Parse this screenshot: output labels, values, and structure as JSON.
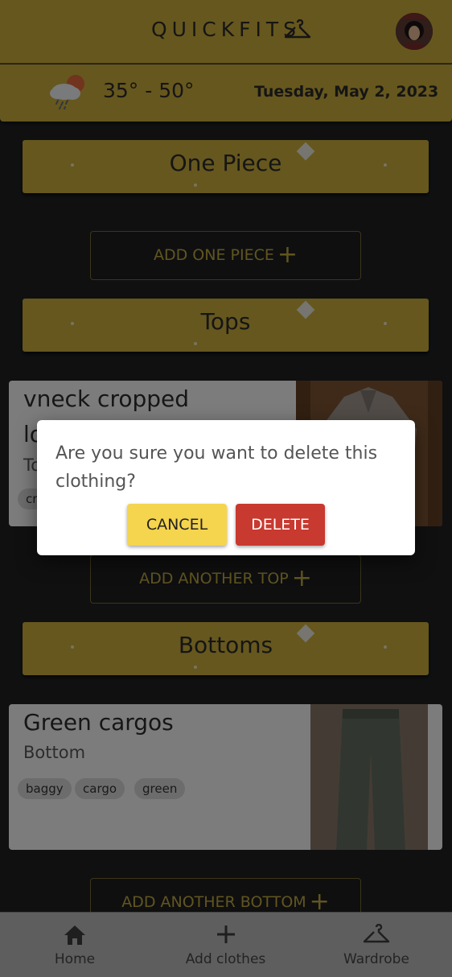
{
  "header": {
    "brand": "QUICKFITS",
    "brand_icon": "hanger-icon",
    "avatar_icon": "user-avatar"
  },
  "weather": {
    "icon": "rain-cloud-sun-icon",
    "temperature_range": "35° - 50°",
    "date": "Tuesday, May 2, 2023"
  },
  "sections": {
    "one_piece": {
      "title": "One Piece",
      "add_label": "ADD ONE PIECE"
    },
    "tops": {
      "title": "Tops",
      "add_label": "ADD ANOTHER TOP"
    },
    "bottoms": {
      "title": "Bottoms",
      "add_label": "ADD ANOTHER BOTTOM"
    }
  },
  "tops_card": {
    "name_line1": "vneck cropped",
    "name_line2": "lo",
    "type": "To",
    "tag_partial": "cr"
  },
  "bottoms_card": {
    "name": "Green cargos",
    "type": "Bottom",
    "tags": [
      "baggy",
      "cargo",
      "green"
    ]
  },
  "dialog": {
    "message": "Are you sure you want to delete this clothing?",
    "cancel_label": "CANCEL",
    "delete_label": "DELETE"
  },
  "nav": {
    "items": [
      {
        "label": "Home",
        "icon": "home-icon"
      },
      {
        "label": "Add clothes",
        "icon": "plus-icon"
      },
      {
        "label": "Wardrobe",
        "icon": "hanger-icon"
      }
    ]
  },
  "colors": {
    "gold": "#c4a83a",
    "background": "#1f2022",
    "cancel": "#f5d44e",
    "delete": "#c8392f",
    "nav": "#b4b4b4"
  }
}
